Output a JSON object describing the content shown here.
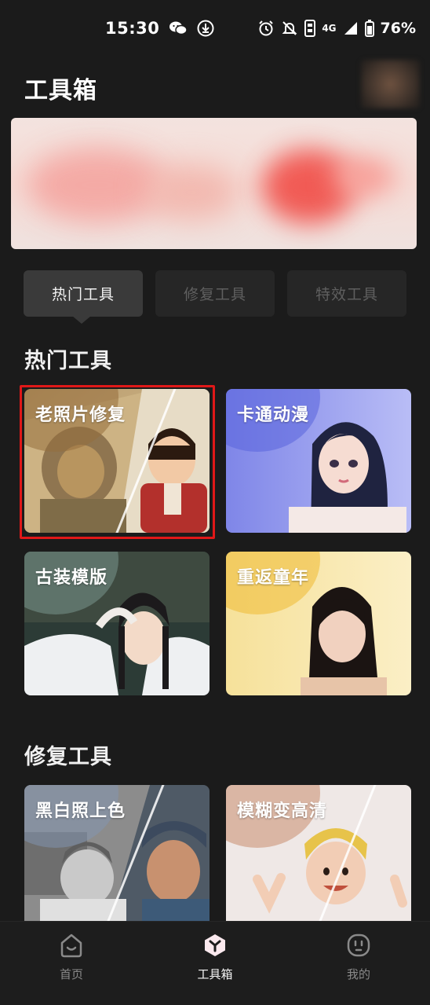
{
  "status_bar": {
    "time": "15:30",
    "icons_left": [
      "wechat-icon",
      "download-icon"
    ],
    "icons_right": [
      "alarm-icon",
      "mute-icon",
      "sim-icon",
      "4g-icon",
      "signal-icon",
      "battery-icon"
    ],
    "network": "4G",
    "battery": "76%"
  },
  "header": {
    "title": "工具箱"
  },
  "tabs": [
    {
      "label": "热门工具",
      "active": true
    },
    {
      "label": "修复工具",
      "active": false
    },
    {
      "label": "特效工具",
      "active": false
    }
  ],
  "sections": {
    "hot": {
      "title": "热门工具",
      "cards": [
        {
          "label": "老照片修复"
        },
        {
          "label": "卡通动漫"
        },
        {
          "label": "古装模版"
        },
        {
          "label": "重返童年"
        }
      ]
    },
    "repair": {
      "title": "修复工具",
      "cards": [
        {
          "label": "黑白照上色"
        },
        {
          "label": "模糊变高清"
        }
      ]
    }
  },
  "bottom_nav": [
    {
      "label": "首页",
      "icon": "home-face-icon",
      "active": false
    },
    {
      "label": "工具箱",
      "icon": "toolbox-cube-icon",
      "active": true
    },
    {
      "label": "我的",
      "icon": "profile-face-icon",
      "active": false
    }
  ],
  "colors": {
    "background": "#1b1b1b",
    "highlight": "#e01818",
    "tab_active": "#3a3a3a",
    "tab_inactive": "#262626"
  }
}
